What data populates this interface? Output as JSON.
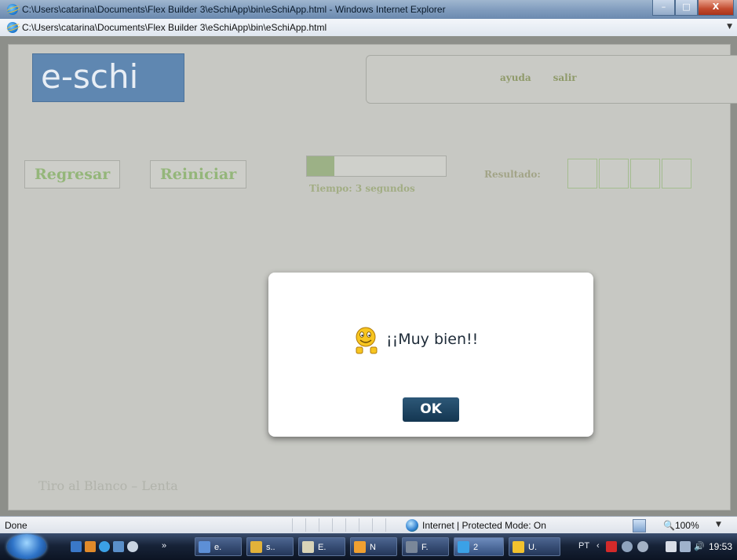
{
  "window": {
    "title": "C:\\Users\\catarina\\Documents\\Flex Builder 3\\eSchiApp\\bin\\eSchiApp.html - Windows Internet Explorer",
    "address": "C:\\Users\\catarina\\Documents\\Flex Builder 3\\eSchiApp\\bin\\eSchiApp.html",
    "controls": {
      "minimize": "–",
      "maximize": "□",
      "close": "X"
    }
  },
  "app": {
    "logo": "e-schi",
    "links": {
      "help": "ayuda",
      "exit": "salir"
    },
    "buttons": {
      "back": "Regresar",
      "restart": "Reiniciar"
    },
    "progress_fraction": 0.2,
    "time_label": "Tiempo: 3 segundos",
    "result_label": "Resultado:",
    "result_box_count": 4,
    "footer": "Tiro al Blanco – Lenta"
  },
  "dialog": {
    "icon": "smiley-icon",
    "message": "¡¡Muy bien!!",
    "ok_label": "OK"
  },
  "statusbar": {
    "status": "Done",
    "zone": "Internet | Protected Mode: On",
    "zoom": "100%"
  },
  "taskbar": {
    "overflow": "»",
    "tasks": [
      {
        "label": "e.",
        "icon": "word-doc-icon",
        "color": "#5d8fd6"
      },
      {
        "label": "s..",
        "icon": "paint-icon",
        "color": "#e2b23a"
      },
      {
        "label": "E.",
        "icon": "explorer-icon",
        "color": "#d9d4b8"
      },
      {
        "label": "N",
        "icon": "notes-icon",
        "color": "#f0a030"
      },
      {
        "label": "F.",
        "icon": "flex-icon",
        "color": "#7a8799"
      },
      {
        "label": "2",
        "icon": "ie-group-icon",
        "color": "#3ba1e6"
      },
      {
        "label": "U.",
        "icon": "messenger-icon",
        "color": "#f2c22e"
      }
    ],
    "language": "PT",
    "clock": "19:53"
  }
}
